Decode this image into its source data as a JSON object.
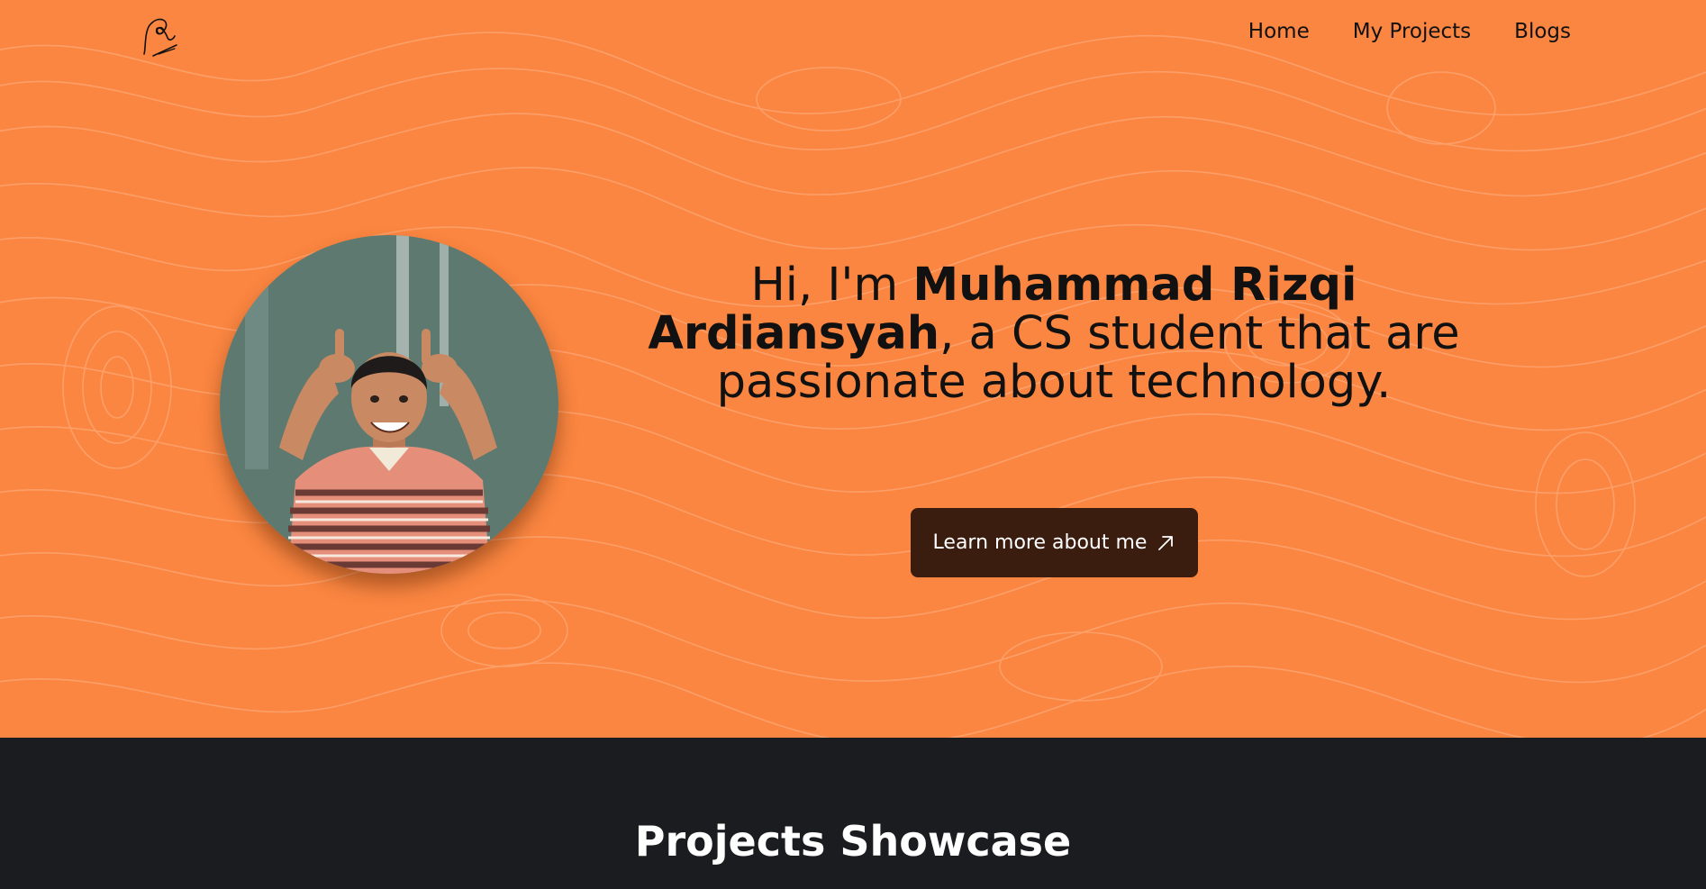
{
  "header": {
    "logo_icon": "signature-logo-icon",
    "nav": [
      {
        "label": "Home"
      },
      {
        "label": "My Projects"
      },
      {
        "label": "Blogs"
      }
    ]
  },
  "hero": {
    "intro_prefix": "Hi, I'm ",
    "name": "Muhammad Rizqi Ardiansyah",
    "intro_suffix": ", a CS student that are passionate about technology.",
    "cta_label": "Learn more about me",
    "cta_icon": "arrow-up-right-icon",
    "background_color": "#fb8641"
  },
  "projects": {
    "title": "Projects Showcase",
    "background_color": "#1b1c20"
  }
}
